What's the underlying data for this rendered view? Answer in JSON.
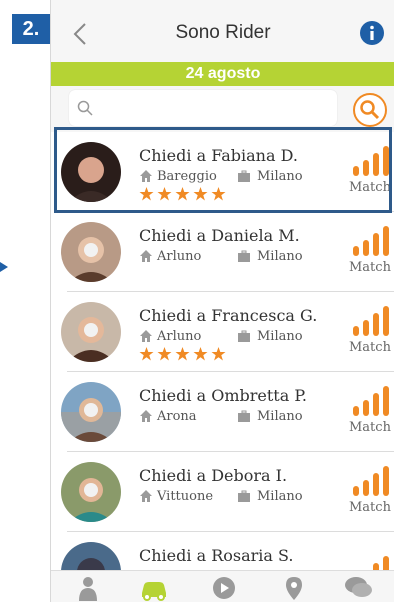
{
  "step_badge": "2.",
  "header": {
    "title": "Sono Rider"
  },
  "date_bar": "24 agosto",
  "search": {
    "placeholder": ""
  },
  "list": [
    {
      "name": "Chiedi a Fabiana D.",
      "from": "Bareggio",
      "to": "Milano",
      "stars": 5,
      "match_label": "Match",
      "match_level": 4
    },
    {
      "name": "Chiedi a Daniela M.",
      "from": "Arluno",
      "to": "Milano",
      "stars": 0,
      "match_label": "Match",
      "match_level": 4
    },
    {
      "name": "Chiedi a Francesca G.",
      "from": "Arluno",
      "to": "Milano",
      "stars": 5,
      "match_label": "Match",
      "match_level": 4
    },
    {
      "name": "Chiedi a Ombretta P.",
      "from": "Arona",
      "to": "Milano",
      "stars": 0,
      "match_label": "Match",
      "match_level": 4
    },
    {
      "name": "Chiedi a Debora I.",
      "from": "Vittuone",
      "to": "Milano",
      "stars": 0,
      "match_label": "Match",
      "match_level": 4
    },
    {
      "name": "Chiedi a Rosaria S.",
      "from": "",
      "to": "",
      "stars": 0,
      "match_label": "",
      "match_level": 4
    }
  ],
  "colors": {
    "accent_orange": "#f08a24",
    "green": "#b5d334",
    "blue": "#1f5fa6",
    "grey_icon": "#9a9a9a"
  },
  "tabs": [
    "person-icon",
    "car-icon",
    "play-icon",
    "location-pin-icon",
    "chat-icon"
  ]
}
